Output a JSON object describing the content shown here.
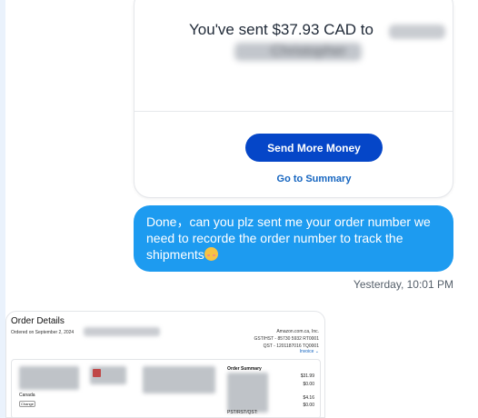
{
  "payment_card": {
    "headline": "You've sent $37.93 CAD to",
    "recipient_visible_fragment": "Christopher",
    "send_more_label": "Send More Money",
    "summary_link_label": "Go to Summary"
  },
  "message": {
    "text": "Done，can you plz sent me your order number we need to recorde the order number to track the shipments",
    "emoji": "smiling-face-icon",
    "timestamp": "Yesterday, 10:01 PM"
  },
  "order_screenshot": {
    "title": "Order Details",
    "ordered_on": "Ordered on September 2, 2024",
    "seller_lines": [
      "Amazon.com.ca, Inc.",
      "GST/HST - 85730 5932 RT0001",
      "QST - 1201187016 TQ0001"
    ],
    "invoice_label": "Invoice ⌄",
    "country": "Canada",
    "change_label": "Change",
    "summary_title": "Order Summary",
    "summary_rows": [
      {
        "label": "",
        "value": "$31.99"
      },
      {
        "label": "",
        "value": "$0.00"
      },
      {
        "label": "",
        "value": "$4.16"
      },
      {
        "label": "",
        "value": "$0.00"
      },
      {
        "label": "PST/RST/QST:",
        "value": ""
      }
    ]
  },
  "colors": {
    "bubble": "#1d9bf0",
    "primary_button": "#0546c8",
    "link": "#1565c0"
  }
}
